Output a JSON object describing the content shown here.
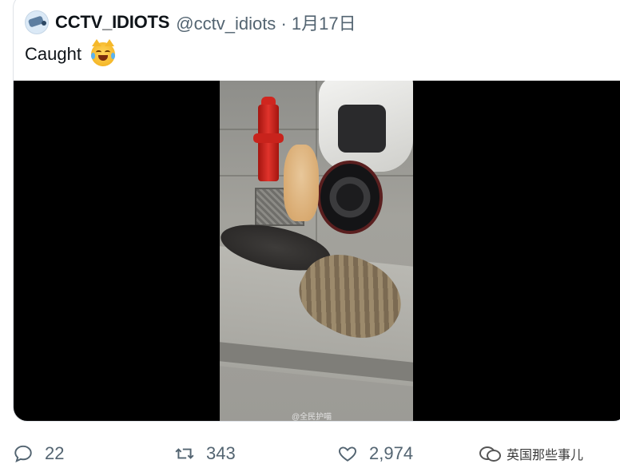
{
  "tweet": {
    "display_name": "CCTV_IDIOTS",
    "handle": "@cctv_idiots",
    "separator": "·",
    "date": "1月17日",
    "text": "Caught",
    "emoji_icon": "joy-cat-emoji-icon",
    "avatar_icon": "security-camera-icon"
  },
  "media": {
    "watermark": "@全民护喵"
  },
  "actions": {
    "reply_count": "22",
    "retweet_count": "343",
    "like_count": "2,974"
  },
  "brand": {
    "label": "英国那些事儿",
    "icon": "wechat-icon"
  },
  "colors": {
    "secondary_text": "#536471",
    "primary_text": "#0f1419",
    "card_border": "#dfe3e8",
    "media_background": "#000000"
  }
}
